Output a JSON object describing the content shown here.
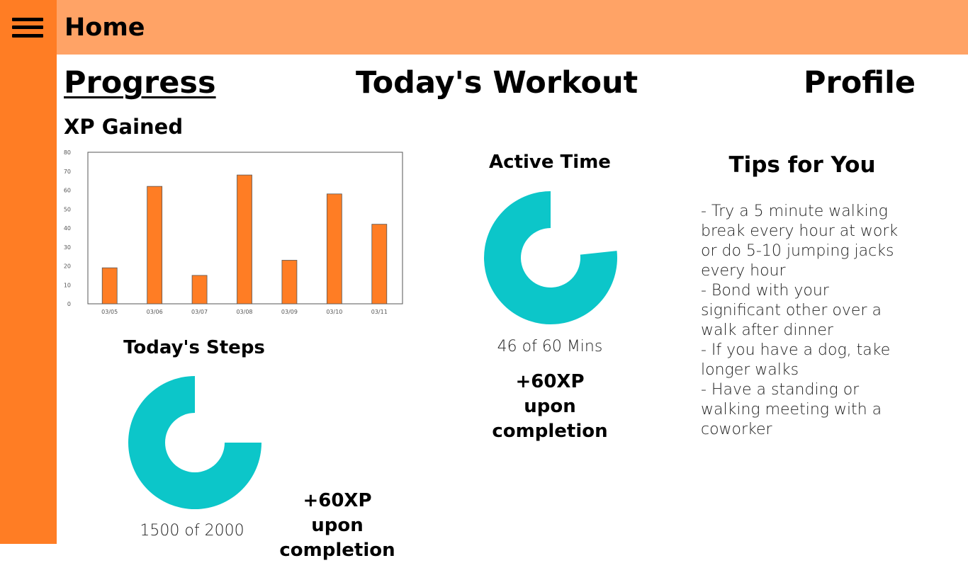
{
  "header": {
    "title": "Home"
  },
  "tabs": {
    "progress": "Progress",
    "workout": "Today's Workout",
    "profile": "Profile"
  },
  "xp": {
    "title": "XP Gained"
  },
  "chart_data": {
    "type": "bar",
    "categories": [
      "03/05",
      "03/06",
      "03/07",
      "03/08",
      "03/09",
      "03/10",
      "03/11"
    ],
    "values": [
      19,
      62,
      15,
      68,
      23,
      58,
      42
    ],
    "ylim": [
      0,
      80
    ],
    "yticks": [
      0,
      10,
      20,
      30,
      40,
      50,
      60,
      70,
      80
    ],
    "title": "",
    "xlabel": "",
    "ylabel": "",
    "grid": false,
    "bar_color": "#ff7d24"
  },
  "steps": {
    "title": "Today's Steps",
    "current": 1500,
    "goal": 2000,
    "stat": "1500 of 2000",
    "reward": "+60XP upon completion",
    "color": "#0cc6c9"
  },
  "active_time": {
    "title": "Active Time",
    "current": 46,
    "goal": 60,
    "stat": "46 of 60 Mins",
    "reward": "+60XP upon completion",
    "color": "#0cc6c9"
  },
  "tips": {
    "title": "Tips for You",
    "text": "- Try a 5 minute walking break every hour at work or do 5-10 jumping jacks every hour\n- Bond with your significant other over a walk after dinner\n- If you have a dog, take longer walks\n- Have a standing or walking meeting with a coworker"
  },
  "colors": {
    "sidebar": "#ff7d24",
    "topbar": "#ffa366",
    "accent": "#0cc6c9"
  }
}
